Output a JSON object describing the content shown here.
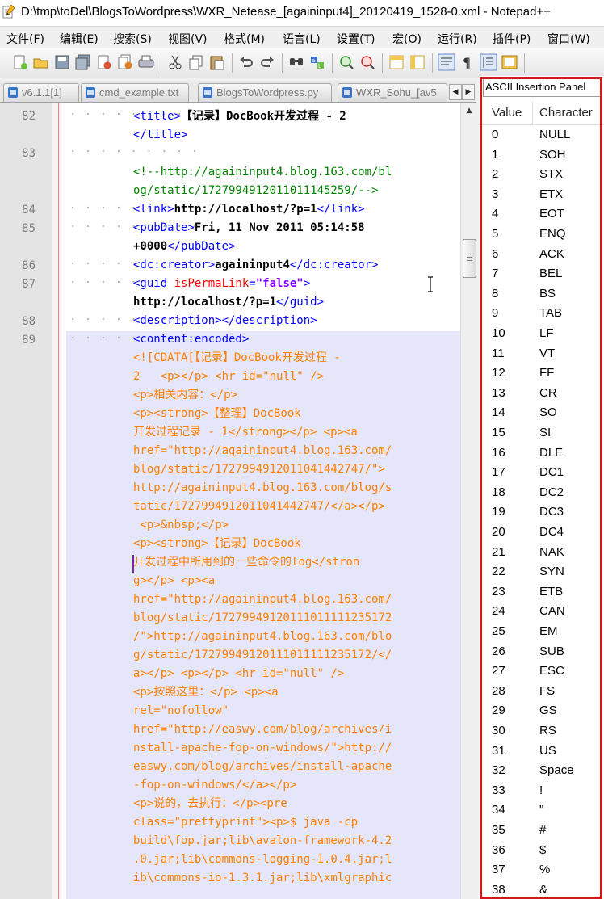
{
  "window": {
    "title": "D:\\tmp\\toDel\\BlogsToWordpress\\WXR_Netease_[againinput4]_20120419_1528-0.xml - Notepad++"
  },
  "menu": [
    "文件(F)",
    "编辑(E)",
    "搜索(S)",
    "视图(V)",
    "格式(M)",
    "语言(L)",
    "设置(T)",
    "宏(O)",
    "运行(R)",
    "插件(P)",
    "窗口(W)"
  ],
  "toolbar_icons": [
    "new-file-icon",
    "open-file-icon",
    "save-icon",
    "save-all-icon",
    "close-icon",
    "close-all-icon",
    "print-icon",
    "cut-icon",
    "copy-icon",
    "paste-icon",
    "undo-icon",
    "redo-icon",
    "find-icon",
    "replace-icon",
    "zoom-in-icon",
    "zoom-out-icon",
    "sync-vertical-icon",
    "sync-horizontal-icon",
    "word-wrap-icon",
    "show-all-chars-icon",
    "indent-guide-icon",
    "user-defined-lang-icon"
  ],
  "tabs": [
    "v6.1.1[1]",
    "cmd_example.txt",
    "BlogsToWordpress.py",
    "WXR_Sohu_[av5"
  ],
  "panel": {
    "title": "ASCII Insertion Panel",
    "col_value": "Value",
    "col_character": "Character",
    "rows": [
      [
        "0",
        "NULL"
      ],
      [
        "1",
        "SOH"
      ],
      [
        "2",
        "STX"
      ],
      [
        "3",
        "ETX"
      ],
      [
        "4",
        "EOT"
      ],
      [
        "5",
        "ENQ"
      ],
      [
        "6",
        "ACK"
      ],
      [
        "7",
        "BEL"
      ],
      [
        "8",
        "BS"
      ],
      [
        "9",
        "TAB"
      ],
      [
        "10",
        "LF"
      ],
      [
        "11",
        "VT"
      ],
      [
        "12",
        "FF"
      ],
      [
        "13",
        "CR"
      ],
      [
        "14",
        "SO"
      ],
      [
        "15",
        "SI"
      ],
      [
        "16",
        "DLE"
      ],
      [
        "17",
        "DC1"
      ],
      [
        "18",
        "DC2"
      ],
      [
        "19",
        "DC3"
      ],
      [
        "20",
        "DC4"
      ],
      [
        "21",
        "NAK"
      ],
      [
        "22",
        "SYN"
      ],
      [
        "23",
        "ETB"
      ],
      [
        "24",
        "CAN"
      ],
      [
        "25",
        "EM"
      ],
      [
        "26",
        "SUB"
      ],
      [
        "27",
        "ESC"
      ],
      [
        "28",
        "FS"
      ],
      [
        "29",
        "GS"
      ],
      [
        "30",
        "RS"
      ],
      [
        "31",
        "US"
      ],
      [
        "32",
        "Space"
      ],
      [
        "33",
        "!"
      ],
      [
        "34",
        "\""
      ],
      [
        "35",
        "#"
      ],
      [
        "36",
        "$"
      ],
      [
        "37",
        "%"
      ],
      [
        "38",
        "&"
      ]
    ]
  },
  "editor": {
    "line_numbers": [
      "82",
      "83",
      "84",
      "85",
      "86",
      "87",
      "88",
      "89"
    ],
    "lines": [
      [
        [
          "tag",
          "<title>"
        ],
        [
          "txt",
          "【记录】DocBook开发过程 - 2"
        ]
      ],
      [
        [
          "tag",
          "</title>"
        ]
      ],
      [],
      [
        [
          "cmt",
          "<!--http://againinput4.blog.163.com/bl"
        ]
      ],
      [
        [
          "cmt",
          "og/static/1727994912011011145259/-->"
        ]
      ],
      [
        [
          "tag",
          "<link>"
        ],
        [
          "txt",
          "http://localhost/?p=1"
        ],
        [
          "tag",
          "</link>"
        ]
      ],
      [
        [
          "tag",
          "<pubDate>"
        ],
        [
          "txt",
          "Fri, 11 Nov 2011 05:14:58"
        ]
      ],
      [
        [
          "txt",
          "+0000"
        ],
        [
          "tag",
          "</pubDate>"
        ]
      ],
      [
        [
          "tag",
          "<dc:creator>"
        ],
        [
          "txt",
          "againinput4"
        ],
        [
          "tag",
          "</dc:creator>"
        ]
      ],
      [
        [
          "tag",
          "<guid "
        ],
        [
          "attr",
          "isPermaLink"
        ],
        [
          "tag",
          "="
        ],
        [
          "str",
          "\"false\""
        ],
        [
          "tag",
          ">"
        ]
      ],
      [
        [
          "txt",
          "http://localhost/?p=1"
        ],
        [
          "tag",
          "</guid>"
        ]
      ],
      [
        [
          "tag",
          "<description></description>"
        ]
      ],
      [
        [
          "tag",
          "<content:encoded>"
        ]
      ],
      [
        [
          "cdata",
          "<![CDATA[【记录】DocBook开发过程 -"
        ]
      ],
      [
        [
          "cdata",
          "2   <p></p> <hr id=\"null\" />"
        ]
      ],
      [
        [
          "cdata",
          "<p>相关内容：</p>"
        ]
      ],
      [
        [
          "cdata",
          "<p><strong>【整理】DocBook"
        ]
      ],
      [
        [
          "cdata",
          "开发过程记录 - 1</strong></p> <p><a"
        ]
      ],
      [
        [
          "cdata",
          "href=\"http://againinput4.blog.163.com/"
        ]
      ],
      [
        [
          "cdata",
          "blog/static/1727994912011041442747/\">"
        ]
      ],
      [
        [
          "cdata",
          "http://againinput4.blog.163.com/blog/s"
        ]
      ],
      [
        [
          "cdata",
          "tatic/1727994912011041442747/</a></p>"
        ]
      ],
      [
        [
          "cdata",
          " <p>&nbsp;</p>"
        ]
      ],
      [
        [
          "cdata",
          "<p><strong>【记录】DocBook"
        ]
      ],
      [
        [
          "cdata",
          "开发过程中所用到的一些命令的log</stron"
        ]
      ],
      [
        [
          "cdata",
          "g></p> <p><a"
        ]
      ],
      [
        [
          "cdata",
          "href=\"http://againinput4.blog.163.com/"
        ]
      ],
      [
        [
          "cdata",
          "blog/static/17279949120111011111235172"
        ]
      ],
      [
        [
          "cdata",
          "/\">http://againinput4.blog.163.com/blo"
        ]
      ],
      [
        [
          "cdata",
          "g/static/17279949120111011111235172/</"
        ]
      ],
      [
        [
          "cdata",
          "a></p> <p></p> <hr id=\"null\" />"
        ]
      ],
      [
        [
          "cdata",
          "<p>按照这里：</p> <p><a"
        ]
      ],
      [
        [
          "cdata",
          "rel=\"nofollow\""
        ]
      ],
      [
        [
          "cdata",
          "href=\"http://easwy.com/blog/archives/i"
        ]
      ],
      [
        [
          "cdata",
          "nstall-apache-fop-on-windows/\">http://"
        ]
      ],
      [
        [
          "cdata",
          "easwy.com/blog/archives/install-apache"
        ]
      ],
      [
        [
          "cdata",
          "-fop-on-windows/</a></p>"
        ]
      ],
      [
        [
          "cdata",
          "<p>说的，去执行：</p><pre"
        ]
      ],
      [
        [
          "cdata",
          "class=\"prettyprint\"><p>$ java -cp"
        ]
      ],
      [
        [
          "cdata",
          "build\\fop.jar;lib\\avalon-framework-4.2"
        ]
      ],
      [
        [
          "cdata",
          ".0.jar;lib\\commons-logging-1.0.4.jar;l"
        ]
      ],
      [
        [
          "cdata",
          "ib\\commons-io-1.3.1.jar;lib\\xmlgraphic"
        ]
      ]
    ]
  }
}
